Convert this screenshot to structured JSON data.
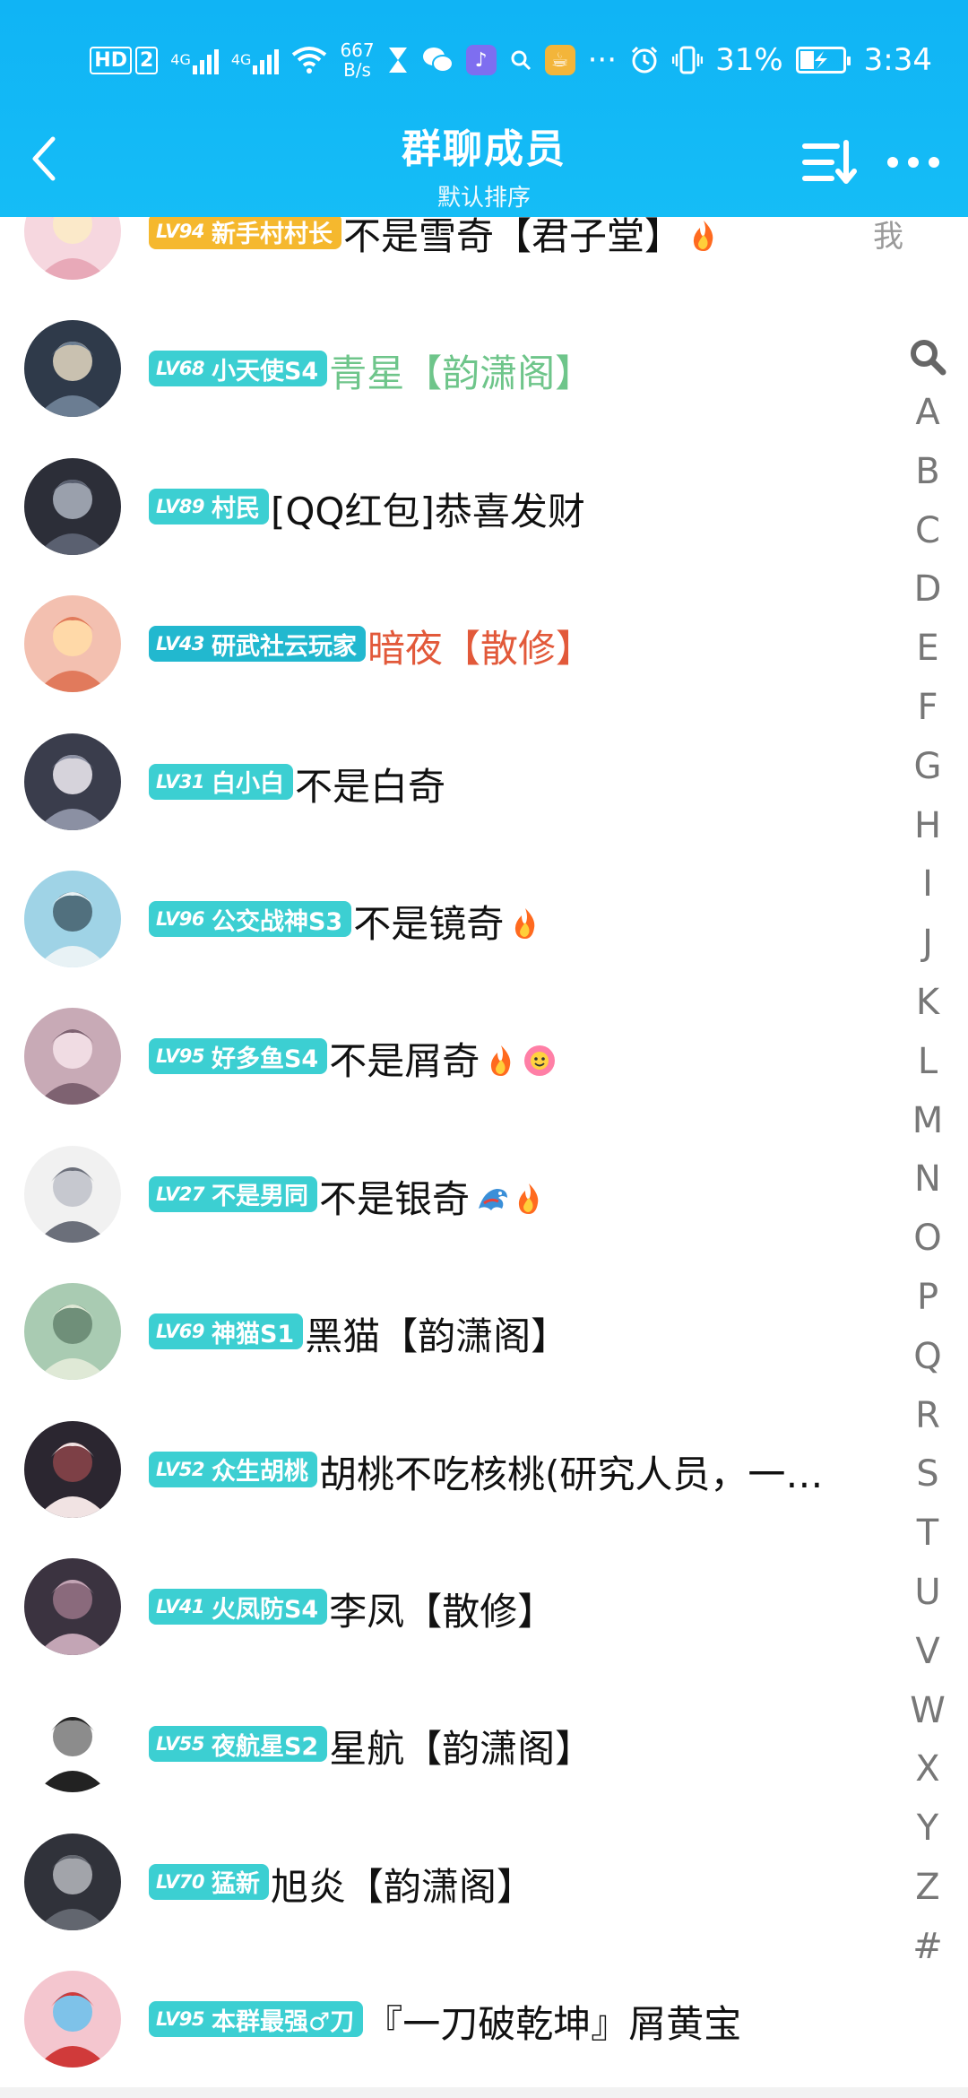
{
  "status_bar": {
    "hd_label": "HD",
    "hd_badge": "2",
    "net1": "4G",
    "net2": "4G",
    "speed_value": "667",
    "speed_unit": "B/s",
    "battery": "31%",
    "time": "3:34",
    "dots": "···",
    "icons": [
      "hourglass-icon",
      "wechat-icon",
      "music-app-icon",
      "search-icon",
      "cup-app-icon",
      "alarm-icon",
      "vibrate-icon",
      "charging-battery-icon"
    ]
  },
  "header": {
    "title": "群聊成员",
    "subtitle": "默认排序"
  },
  "me_label": "我",
  "members": [
    {
      "level": "LV94",
      "title": "新手村村长",
      "name": "不是雪奇【君子堂】",
      "badge_color": "#f5b82e",
      "name_color": "#111111",
      "emojis": [
        "fire"
      ],
      "is_me": true
    },
    {
      "level": "LV68",
      "title": "小天使S4",
      "name": "青星【韵潇阁】",
      "badge_color": "#3ccfd2",
      "name_color": "#6ec58a",
      "emojis": [],
      "is_me": false
    },
    {
      "level": "LV89",
      "title": "村民",
      "name": "[QQ红包]恭喜发财",
      "badge_color": "#3ccfd2",
      "name_color": "#111111",
      "emojis": [],
      "is_me": false
    },
    {
      "level": "LV43",
      "title": "研武社云玩家",
      "name": "暗夜【散修】",
      "badge_color": "#22b8cf",
      "name_color": "#e2593a",
      "emojis": [],
      "is_me": false
    },
    {
      "level": "LV31",
      "title": "白小白",
      "name": "不是白奇",
      "badge_color": "#3ccfd2",
      "name_color": "#111111",
      "emojis": [],
      "is_me": false
    },
    {
      "level": "LV96",
      "title": "公交战神S3",
      "name": "不是镜奇",
      "badge_color": "#3ccfd2",
      "name_color": "#111111",
      "emojis": [
        "fire"
      ],
      "is_me": false
    },
    {
      "level": "LV95",
      "title": "好多鱼S4",
      "name": "不是屑奇",
      "badge_color": "#3ccfd2",
      "name_color": "#111111",
      "emojis": [
        "fire",
        "flower"
      ],
      "is_me": false
    },
    {
      "level": "LV27",
      "title": "不是男同",
      "name": "不是银奇",
      "badge_color": "#3ccfd2",
      "name_color": "#111111",
      "emojis": [
        "dragon",
        "fire"
      ],
      "is_me": false
    },
    {
      "level": "LV69",
      "title": "神猫S1",
      "name": "黑猫【韵潇阁】",
      "badge_color": "#3ccfd2",
      "name_color": "#111111",
      "emojis": [],
      "is_me": false
    },
    {
      "level": "LV52",
      "title": "众生胡桃",
      "name": "胡桃不吃核桃(研究人员，一…",
      "badge_color": "#3ccfd2",
      "name_color": "#111111",
      "emojis": [],
      "is_me": false
    },
    {
      "level": "LV41",
      "title": "火凤防S4",
      "name": "李凤【散修】",
      "badge_color": "#3ccfd2",
      "name_color": "#111111",
      "emojis": [],
      "is_me": false
    },
    {
      "level": "LV55",
      "title": "夜航星S2",
      "name": "星航【韵潇阁】",
      "badge_color": "#3ccfd2",
      "name_color": "#111111",
      "emojis": [],
      "is_me": false
    },
    {
      "level": "LV70",
      "title": "猛新",
      "name": "旭炎【韵潇阁】",
      "badge_color": "#3ccfd2",
      "name_color": "#111111",
      "emojis": [],
      "is_me": false
    },
    {
      "level": "LV95",
      "title": "本群最强♂刀",
      "name": "『一刀破乾坤』屑黄宝",
      "badge_color": "#3ccfd2",
      "name_color": "#111111",
      "emojis": [],
      "is_me": false
    }
  ],
  "index_letters": [
    "A",
    "B",
    "C",
    "D",
    "E",
    "F",
    "G",
    "H",
    "I",
    "J",
    "K",
    "L",
    "M",
    "N",
    "O",
    "P",
    "Q",
    "R",
    "S",
    "T",
    "U",
    "V",
    "W",
    "X",
    "Y",
    "Z",
    "#"
  ],
  "index_search_icon": "search-icon",
  "colors": {
    "header_bg": "#12b7f5",
    "badge_teal": "#3ccfd2",
    "badge_gold": "#f5b82e",
    "index_text": "#777777"
  }
}
